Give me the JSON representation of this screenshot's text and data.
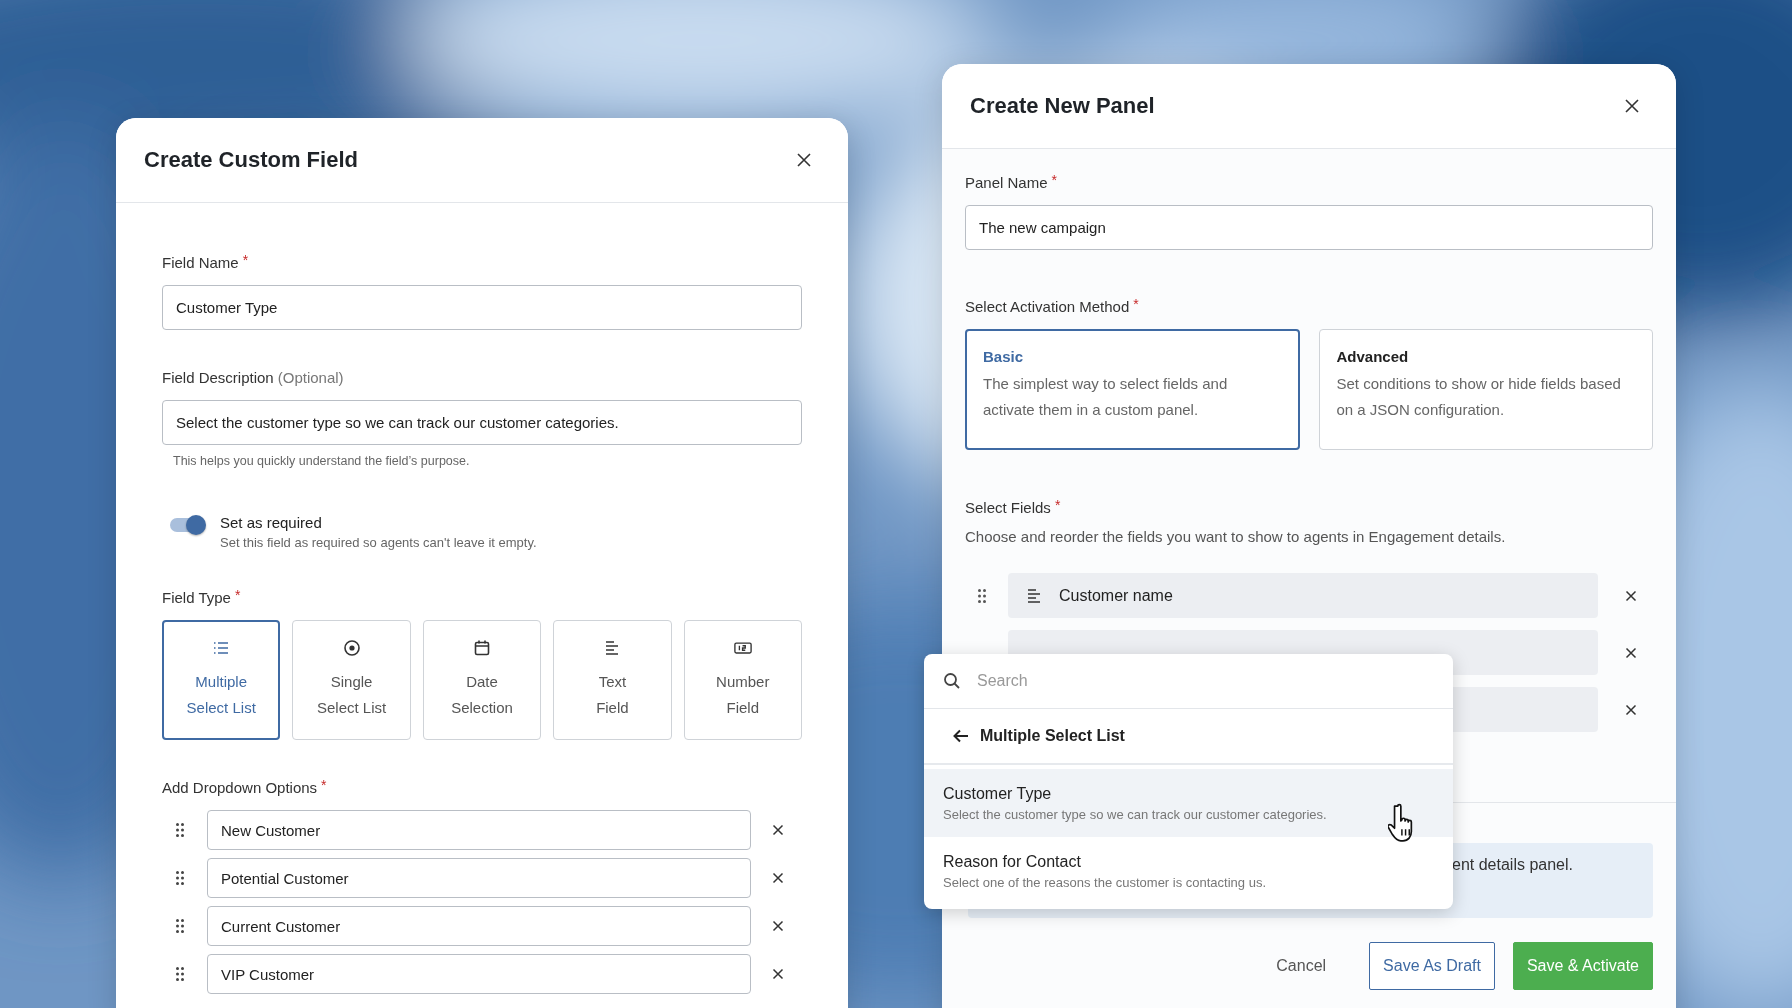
{
  "custom_field_dialog": {
    "title": "Create Custom Field",
    "field_name": {
      "label": "Field Name",
      "required_mark": "*",
      "value": "Customer Type"
    },
    "field_description": {
      "label": "Field Description",
      "optional_note": "(Optional)",
      "value": "Select the customer type so we can track our customer categories.",
      "helper": "This helps you quickly understand the field’s purpose."
    },
    "required_toggle": {
      "on": true,
      "label": "Set as required",
      "description": "Set this field as required so agents can't leave it empty."
    },
    "field_type": {
      "label": "Field Type",
      "required_mark": "*",
      "options": [
        {
          "kind": "list",
          "line1": "Multiple",
          "line2": "Select List",
          "selected": true
        },
        {
          "kind": "radio",
          "line1": "Single",
          "line2": "Select List",
          "selected": false
        },
        {
          "kind": "calendar",
          "line1": "Date",
          "line2": "Selection",
          "selected": false
        },
        {
          "kind": "text",
          "line1": "Text",
          "line2": "Field",
          "selected": false
        },
        {
          "kind": "number",
          "line1": "Number",
          "line2": "Field",
          "selected": false
        }
      ]
    },
    "dropdown_options": {
      "label": "Add Dropdown Options",
      "required_mark": "*",
      "items": [
        "New Customer",
        "Potential Customer",
        "Current Customer",
        "VIP Customer"
      ]
    }
  },
  "panel_dialog": {
    "title": "Create New Panel",
    "panel_name": {
      "label": "Panel Name",
      "required_mark": "*",
      "value": "The new campaign"
    },
    "activation_method": {
      "label": "Select Activation Method",
      "required_mark": "*",
      "options": [
        {
          "title": "Basic",
          "description": "The simplest way to select fields and activate them in a custom panel.",
          "selected": true
        },
        {
          "title": "Advanced",
          "description": "Set conditions to show or hide fields based on a JSON configuration.",
          "selected": false
        }
      ]
    },
    "select_fields": {
      "label": "Select Fields",
      "required_mark": "*",
      "description": "Choose and reorder the fields you want to show to agents in Engagement details.",
      "rows": [
        {
          "kind": "text",
          "name": "Customer name"
        },
        {
          "kind": "covered"
        },
        {
          "kind": "covered"
        }
      ]
    },
    "info_banner": {
      "text": "ent details panel."
    },
    "buttons": [
      {
        "kind": "plain",
        "label": "Cancel"
      },
      {
        "kind": "outline",
        "label": "Save As Draft"
      },
      {
        "kind": "primary",
        "label": "Save & Activate"
      }
    ]
  },
  "field_picker": {
    "search_placeholder": "Search",
    "back_label": "Multiple Select List",
    "items": [
      {
        "title": "Customer Type",
        "description": "Select the customer type so we can track our customer categories.",
        "selected": true
      },
      {
        "title": "Reason for Contact",
        "description": "Select one of the reasons the customer is contacting us.",
        "selected": false
      }
    ]
  }
}
